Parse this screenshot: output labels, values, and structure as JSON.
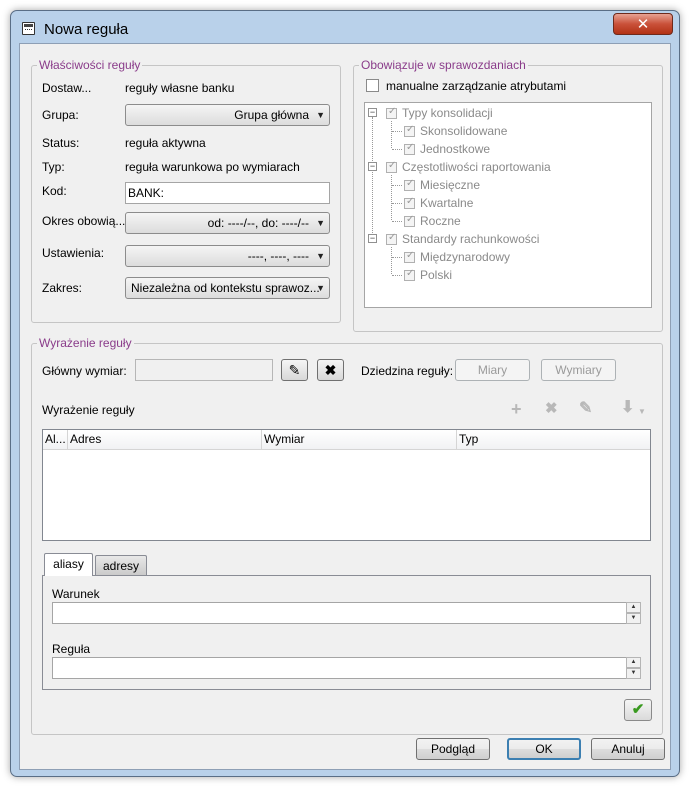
{
  "window": {
    "title": "Nowa reguła",
    "close_glyph": "✕",
    "icon": "calculator-icon"
  },
  "properties": {
    "legend": "Właściwości reguły",
    "supplier_label": "Dostaw...",
    "supplier_value": "reguły własne banku",
    "group_label": "Grupa:",
    "group_value": "Grupa główna",
    "status_label": "Status:",
    "status_value": "reguła aktywna",
    "type_label": "Typ:",
    "type_value": "reguła warunkowa po wymiarach",
    "code_label": "Kod:",
    "code_value": "BANK:",
    "period_label": "Okres obowią...",
    "period_value": "od: ----/--, do: ----/--",
    "settings_label": "Ustawienia:",
    "settings_value": "----, ----, ----",
    "scope_label": "Zakres:",
    "scope_value": "Niezależna od kontekstu sprawoz..."
  },
  "reports": {
    "legend": "Obowiązuje w sprawozdaniach",
    "manual_label": "manualne zarządzanie atrybutami",
    "tree": [
      {
        "label": "Typy konsolidacji",
        "level": 0
      },
      {
        "label": "Skonsolidowane",
        "level": 1
      },
      {
        "label": "Jednostkowe",
        "level": 1
      },
      {
        "label": "Częstotliwości raportowania",
        "level": 0
      },
      {
        "label": "Miesięczne",
        "level": 1
      },
      {
        "label": "Kwartalne",
        "level": 1
      },
      {
        "label": "Roczne",
        "level": 1
      },
      {
        "label": "Standardy rachunkowości",
        "level": 0
      },
      {
        "label": "Międzynarodowy",
        "level": 1
      },
      {
        "label": "Polski",
        "level": 1
      }
    ]
  },
  "expression": {
    "legend": "Wyrażenie reguły",
    "main_dim_label": "Główny wymiar:",
    "main_dim_value": "",
    "domain_label": "Dziedzina reguły:",
    "measures_button": "Miary",
    "dimensions_button": "Wymiary",
    "subheader": "Wyrażenie reguły",
    "columns": [
      "Al...",
      "Adres",
      "Wymiar",
      "Typ"
    ],
    "rows": [],
    "tabs": [
      "aliasy",
      "adresy"
    ],
    "condition_label": "Warunek",
    "condition_value": "",
    "rule_label": "Reguła",
    "rule_value": ""
  },
  "footer": {
    "preview": "Podgląd",
    "ok": "OK",
    "cancel": "Anuluj"
  }
}
